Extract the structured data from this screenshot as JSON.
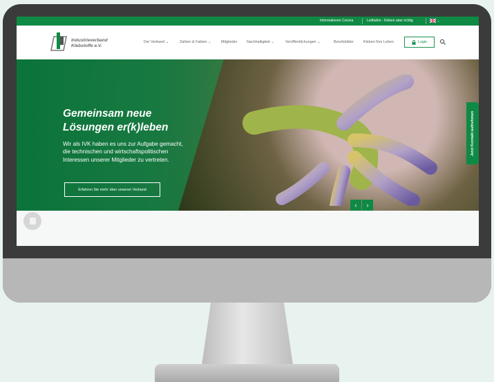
{
  "topbar": {
    "info_corona": "Informationen Corona",
    "leitfaden": "Leitfaden - Kleben aber richtig",
    "lang_chevron": "⌄"
  },
  "logo": {
    "line1": "Industrieverband",
    "line2": "Klebstoffe e.V."
  },
  "menu": {
    "items": [
      {
        "label": "Der Verband",
        "dropdown": true
      },
      {
        "label": "Zahlen & Fakten",
        "dropdown": true
      },
      {
        "label": "Mitglieder",
        "dropdown": false
      },
      {
        "label": "Nachhaltigkeit",
        "dropdown": true
      },
      {
        "label": "Veröffentlichungen",
        "dropdown": true
      },
      {
        "label": "Berufsbilder",
        "dropdown": false
      },
      {
        "label": "Kleben fürs Leben",
        "dropdown": false
      }
    ],
    "login_label": "Login"
  },
  "hero": {
    "headline_line1": "Gemeinsam neue",
    "headline_line2": "Lösungen er(k)leben",
    "paragraph": "Wir als IVK haben es uns zur Aufgabe gemacht, die technischen und wirtschaftspolitischen Interessen unserer Mitglieder zu vertreten.",
    "cta_label": "Erfahren Sie mehr über unseren Verband",
    "prev": "‹",
    "next": "›"
  },
  "side_tab": {
    "label": "Jetzt Kontakt aufnehmen"
  },
  "colors": {
    "brand_green": "#0f8a44",
    "monitor_bezel": "#3b3b3b",
    "monitor_chin": "#b7b7b7",
    "background": "#e8f3ef"
  }
}
